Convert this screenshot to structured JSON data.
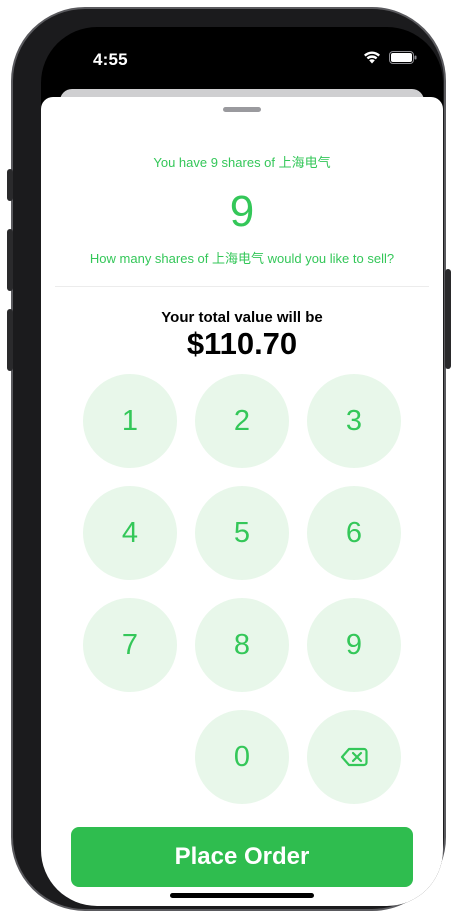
{
  "status_bar": {
    "time": "4:55",
    "icons": [
      "wifi-icon",
      "battery-icon"
    ]
  },
  "sell_sheet": {
    "holding_text": "You have 9 shares of 上海电气",
    "share_quantity": "9",
    "question_text": "How many shares of 上海电气 would you like to sell?",
    "total_label": "Your total value will be",
    "total_value": "$110.70"
  },
  "keypad": {
    "keys": [
      "1",
      "2",
      "3",
      "4",
      "5",
      "6",
      "7",
      "8",
      "9",
      "0"
    ],
    "delete_icon": "backspace-icon"
  },
  "actions": {
    "place_order_label": "Place Order"
  },
  "colors": {
    "accent": "#34c759",
    "key_background": "#e8f7ea",
    "button_background": "#2fbd4f"
  }
}
